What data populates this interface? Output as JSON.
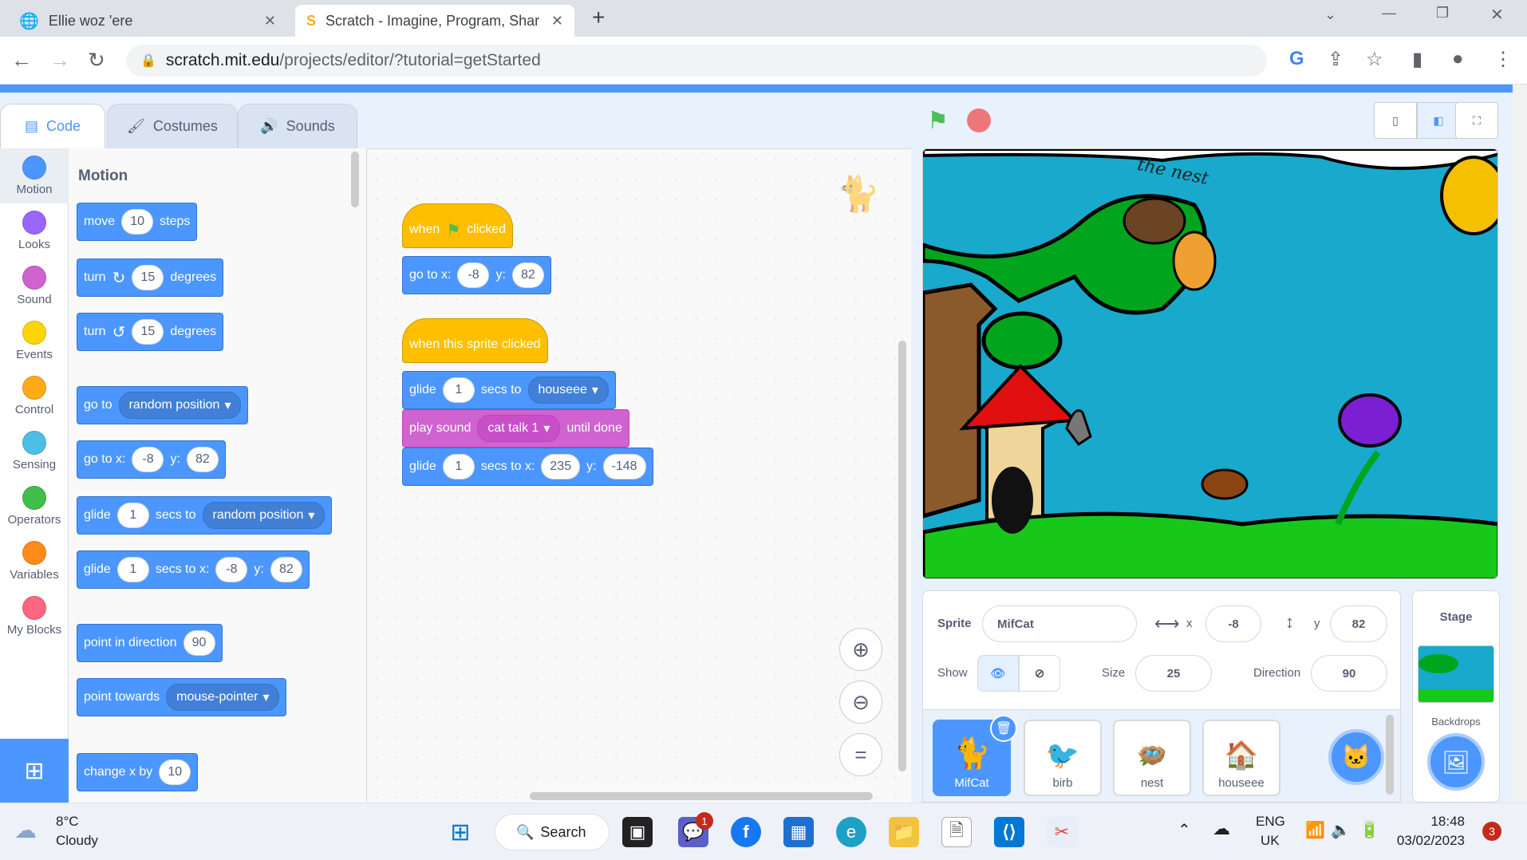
{
  "browser": {
    "tabs": [
      {
        "title": "Ellie woz 'ere",
        "active": false
      },
      {
        "title": "Scratch - Imagine, Program, Shar",
        "active": true
      }
    ],
    "url_host": "scratch.mit.edu",
    "url_path": "/projects/editor/?tutorial=getStarted"
  },
  "editor_tabs": {
    "code": "Code",
    "costumes": "Costumes",
    "sounds": "Sounds"
  },
  "categories": [
    {
      "label": "Motion",
      "color": "#4c97ff"
    },
    {
      "label": "Looks",
      "color": "#9966ff"
    },
    {
      "label": "Sound",
      "color": "#cf63cf"
    },
    {
      "label": "Events",
      "color": "#ffd500"
    },
    {
      "label": "Control",
      "color": "#ffab19"
    },
    {
      "label": "Sensing",
      "color": "#4cbfe6"
    },
    {
      "label": "Operators",
      "color": "#40bf4a"
    },
    {
      "label": "Variables",
      "color": "#ff8c1a"
    },
    {
      "label": "My Blocks",
      "color": "#ff6680"
    }
  ],
  "palette": {
    "heading": "Motion",
    "move": {
      "a": "move",
      "v": "10",
      "b": "steps"
    },
    "turn_right": {
      "a": "turn",
      "v": "15",
      "b": "degrees"
    },
    "turn_left": {
      "a": "turn",
      "v": "15",
      "b": "degrees"
    },
    "goto": {
      "a": "go to",
      "dd": "random position"
    },
    "gotoxy": {
      "a": "go to x:",
      "x": "-8",
      "y_lbl": "y:",
      "y": "82"
    },
    "glide_to": {
      "a": "glide",
      "v": "1",
      "b": "secs to",
      "dd": "random position"
    },
    "glide_xy": {
      "a": "glide",
      "v": "1",
      "b": "secs to x:",
      "x": "-8",
      "y_lbl": "y:",
      "y": "82"
    },
    "point_dir": {
      "a": "point in direction",
      "v": "90"
    },
    "point_towards": {
      "a": "point towards",
      "dd": "mouse-pointer"
    },
    "change_x": {
      "a": "change x by",
      "v": "10"
    }
  },
  "script": {
    "hat1": {
      "a": "when",
      "b": "clicked"
    },
    "goto": {
      "a": "go to x:",
      "x": "-8",
      "y_lbl": "y:",
      "y": "82"
    },
    "hat2": {
      "a": "when this sprite clicked"
    },
    "glide1": {
      "a": "glide",
      "v": "1",
      "b": "secs to",
      "dd": "houseee"
    },
    "sound": {
      "a": "play sound",
      "dd": "cat talk 1",
      "b": "until done"
    },
    "glide2": {
      "a": "glide",
      "v": "1",
      "b": "secs to x:",
      "x": "235",
      "y_lbl": "y:",
      "y": "-148"
    }
  },
  "stage_text": "the nest",
  "sprite_info": {
    "sprite_label": "Sprite",
    "name": "MifCat",
    "x_label": "x",
    "x": "-8",
    "y_label": "y",
    "y": "82",
    "show_label": "Show",
    "size_label": "Size",
    "size": "25",
    "direction_label": "Direction",
    "direction": "90"
  },
  "sprites": [
    {
      "name": "MifCat",
      "selected": true
    },
    {
      "name": "birb"
    },
    {
      "name": "nest"
    },
    {
      "name": "houseee"
    }
  ],
  "stage_panel": {
    "title": "Stage",
    "backdrops": "Backdrops"
  },
  "taskbar": {
    "temp": "8°C",
    "weather": "Cloudy",
    "search": "Search",
    "lang1": "ENG",
    "lang2": "UK",
    "time": "18:48",
    "date": "03/02/2023",
    "notif": "3",
    "teams_badge": "1"
  }
}
